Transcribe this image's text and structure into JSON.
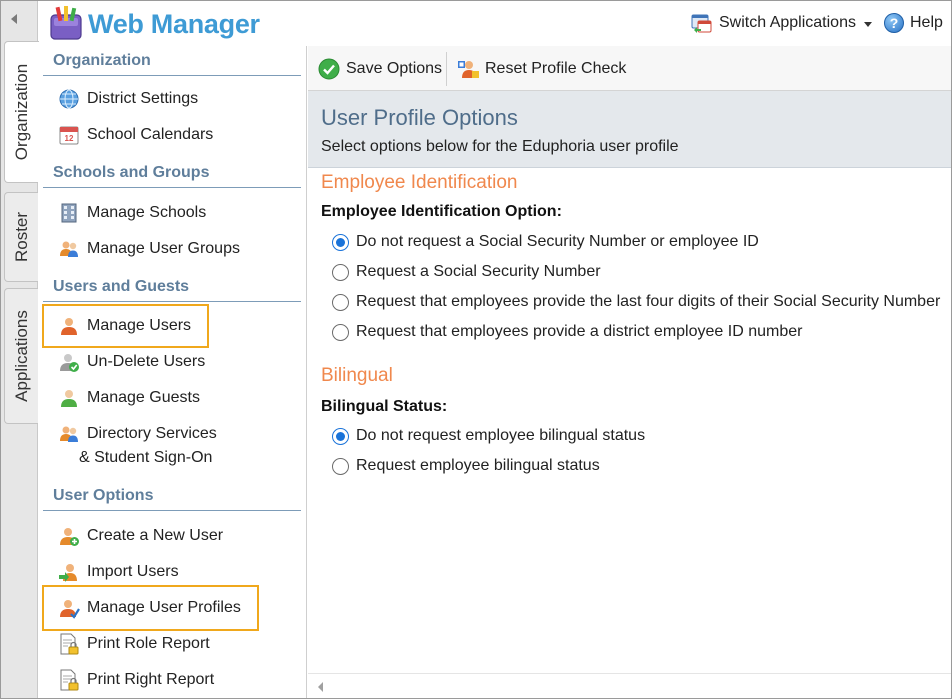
{
  "app": {
    "title": "Web Manager"
  },
  "header": {
    "switch_applications": "Switch Applications",
    "help": "Help"
  },
  "tabs": [
    "Organization",
    "Roster",
    "Applications"
  ],
  "nav": {
    "sections": [
      {
        "title": "Organization",
        "items": [
          "District Settings",
          "School Calendars"
        ]
      },
      {
        "title": "Schools and Groups",
        "items": [
          "Manage Schools",
          "Manage User Groups"
        ]
      },
      {
        "title": "Users and Guests",
        "items": [
          "Manage Users",
          "Un-Delete Users",
          "Manage Guests",
          "Directory Services",
          "& Student Sign-On"
        ]
      },
      {
        "title": "User Options",
        "items": [
          "Create a New User",
          "Import Users",
          "Manage User Profiles",
          "Print Role Report",
          "Print Right Report"
        ]
      }
    ]
  },
  "toolbar": {
    "save": "Save Options",
    "reset": "Reset Profile Check"
  },
  "page": {
    "title": "User Profile Options",
    "subtitle": "Select options below for the Eduphoria user profile"
  },
  "employee_id": {
    "group_title": "Employee Identification",
    "label": "Employee Identification Option:",
    "options": [
      "Do not request a Social Security Number or employee ID",
      "Request a Social Security Number",
      "Request that employees provide the last four digits of their Social Security Number",
      "Request that employees provide a district employee ID number"
    ],
    "selected_index": 0
  },
  "bilingual": {
    "group_title": "Bilingual",
    "label": "Bilingual Status:",
    "options": [
      "Do not request employee bilingual status",
      "Request employee bilingual status"
    ],
    "selected_index": 0
  },
  "colors": {
    "title_blue": "#3e9bd5",
    "section_head": "#5f7e9b",
    "group_orange": "#f0884d",
    "highlight": "#f0a81c",
    "radio_blue": "#1a73d9"
  }
}
